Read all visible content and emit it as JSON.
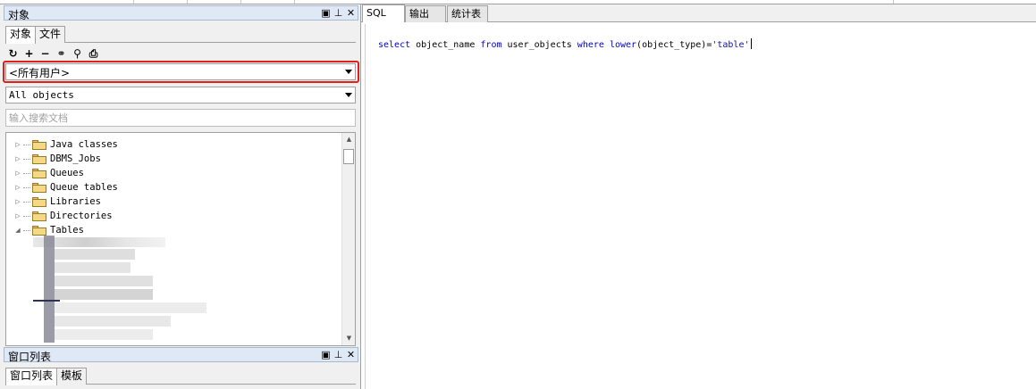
{
  "object_panel": {
    "title": "对象",
    "tabs": [
      "对象",
      "文件"
    ],
    "owner_select": "<所有用户>",
    "type_select": "All objects",
    "search_placeholder": "输入搜索文档",
    "tree_items": [
      {
        "label": "Java classes",
        "expanded": false
      },
      {
        "label": "DBMS_Jobs",
        "expanded": false
      },
      {
        "label": "Queues",
        "expanded": false
      },
      {
        "label": "Queue tables",
        "expanded": false
      },
      {
        "label": "Libraries",
        "expanded": false
      },
      {
        "label": "Directories",
        "expanded": false
      },
      {
        "label": "Tables",
        "expanded": true
      }
    ]
  },
  "window_panel": {
    "title": "窗口列表",
    "tabs": [
      "窗口列表",
      "模板"
    ]
  },
  "editor": {
    "tabs": [
      "SQL",
      "输出",
      "统计表"
    ],
    "active_tab": "SQL",
    "sql_tokens": [
      {
        "text": "select",
        "kind": "kw"
      },
      {
        "text": " object_name ",
        "kind": "id"
      },
      {
        "text": "from",
        "kind": "kw"
      },
      {
        "text": " user_objects ",
        "kind": "id"
      },
      {
        "text": "where",
        "kind": "kw"
      },
      {
        "text": " ",
        "kind": "id"
      },
      {
        "text": "lower",
        "kind": "kw"
      },
      {
        "text": "(object_type)=",
        "kind": "id"
      },
      {
        "text": "'table'",
        "kind": "str"
      }
    ]
  },
  "colors": {
    "highlight_border": "#e0201b",
    "keyword": "#0000c8",
    "folder": "#f3d983"
  }
}
